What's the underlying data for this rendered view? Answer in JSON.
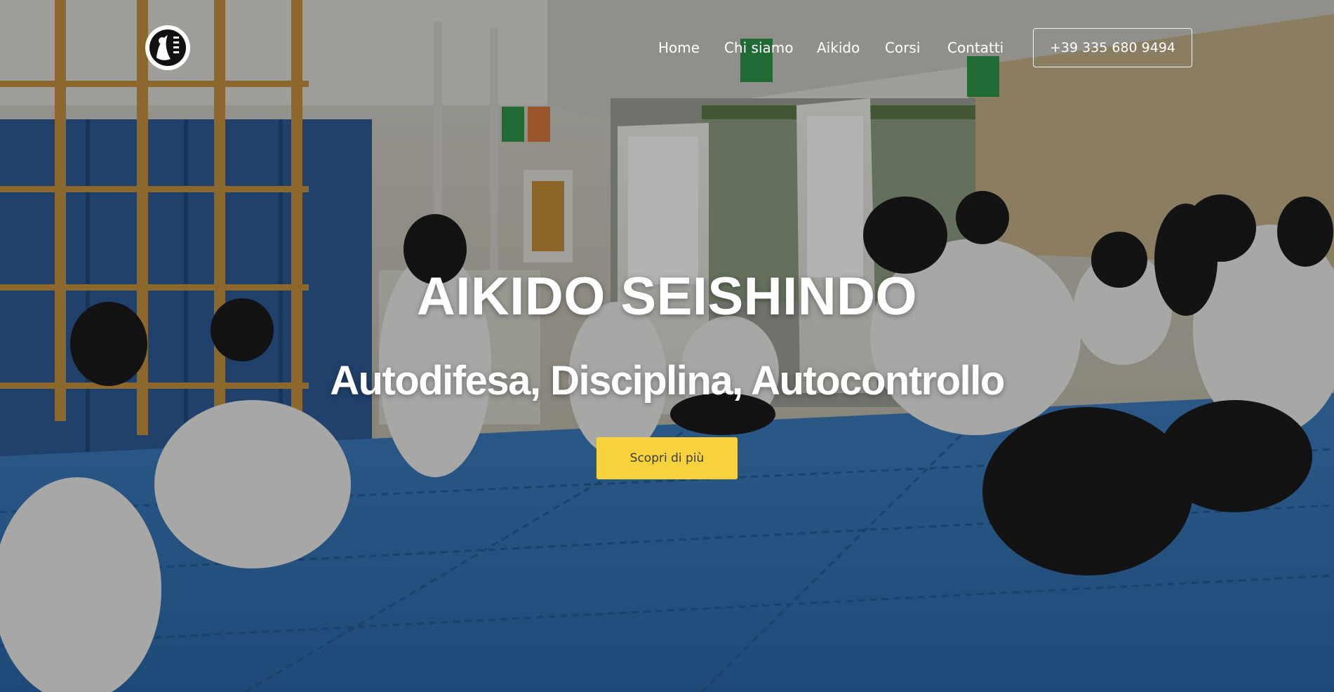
{
  "header": {
    "logo_icon": "aikido-dojo-logo-icon",
    "nav": [
      {
        "label": "Home"
      },
      {
        "label": "Chi siamo"
      },
      {
        "label": "Aikido"
      },
      {
        "label": "Corsi"
      },
      {
        "label": "Contatti"
      }
    ],
    "phone": "+39 335 680 9494"
  },
  "hero": {
    "title": "AIKIDO SEISHINDO",
    "subtitle": "Autodifesa, Disciplina, Autocontrollo",
    "cta_label": "Scopri di più",
    "background": "photo-of-aikido-class-in-gym"
  },
  "colors": {
    "cta_background": "#f7d23c",
    "cta_text": "#3b3b3b",
    "text": "#ffffff",
    "mat_blue": "#3d7fc0"
  }
}
